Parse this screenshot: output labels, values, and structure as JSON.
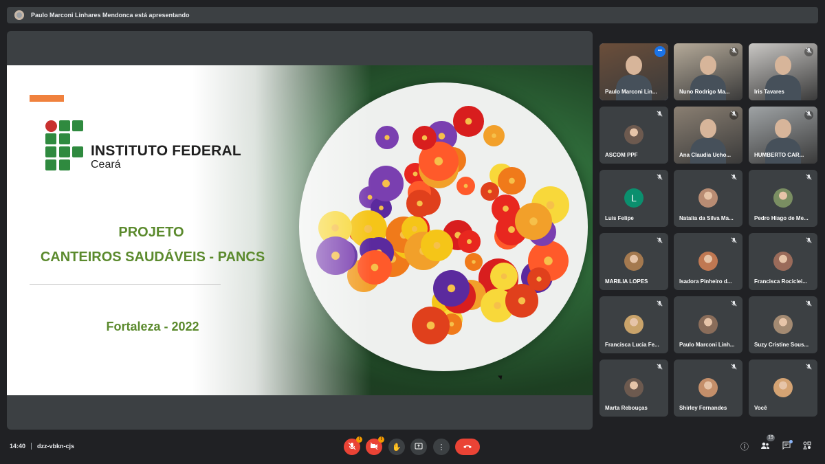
{
  "presenter_banner": {
    "text": "Paulo Marconi Linhares Mendonca está apresentando"
  },
  "slide": {
    "institution_name": "INSTITUTO FEDERAL",
    "institution_sub": "Ceará",
    "project_line1": "PROJETO",
    "project_line2": "CANTEIROS SAUDÁVEIS - PANCS",
    "city_year": "Fortaleza - 2022"
  },
  "participants": [
    {
      "name": "Paulo Marconi Lin...",
      "kind": "video",
      "active": true
    },
    {
      "name": "Nuno Rodrigo Ma...",
      "kind": "video"
    },
    {
      "name": "Iris Tavares",
      "kind": "video"
    },
    {
      "name": "ASCOM PPF",
      "kind": "avatar"
    },
    {
      "name": "Ana Claudia Ucho...",
      "kind": "video"
    },
    {
      "name": "HUMBERTO CAR...",
      "kind": "video"
    },
    {
      "name": "Luis Felipe",
      "kind": "letter",
      "letter": "L"
    },
    {
      "name": "Natalia da Silva Ma...",
      "kind": "avatar"
    },
    {
      "name": "Pedro Hiago de Me...",
      "kind": "avatar"
    },
    {
      "name": "MARILIA LOPES",
      "kind": "avatar"
    },
    {
      "name": "Isadora Pinheiro d...",
      "kind": "avatar"
    },
    {
      "name": "Francisca Rociclei...",
      "kind": "avatar"
    },
    {
      "name": "Francisca Lucia Fe...",
      "kind": "avatar"
    },
    {
      "name": "Paulo Marconi Linh...",
      "kind": "avatar"
    },
    {
      "name": "Suzy Cristine Sous...",
      "kind": "avatar"
    },
    {
      "name": "Marta Rebouças",
      "kind": "avatar"
    },
    {
      "name": "Shirley Fernandes",
      "kind": "avatar"
    },
    {
      "name": "Você",
      "kind": "avatar"
    }
  ],
  "bottom_bar": {
    "time": "14:40",
    "meeting_code": "dzz-vbkn-cjs",
    "participant_count": "19",
    "mic_warning": "!",
    "cam_warning": "!"
  },
  "icons": {
    "mic_off": "mic-off-icon",
    "cam_off": "camera-off-icon",
    "raise_hand": "hand-icon",
    "present": "present-icon",
    "more": "more-vert-icon",
    "end_call": "phone-hangup-icon",
    "info": "info-icon",
    "people": "people-icon",
    "chat": "chat-icon",
    "activities": "activities-icon"
  },
  "colors": {
    "background": "#202124",
    "surface": "#3c4043",
    "danger": "#ea4335",
    "accent": "#1a73e8",
    "slide_green": "#5b8a2d",
    "slide_orange": "#f0813d"
  }
}
